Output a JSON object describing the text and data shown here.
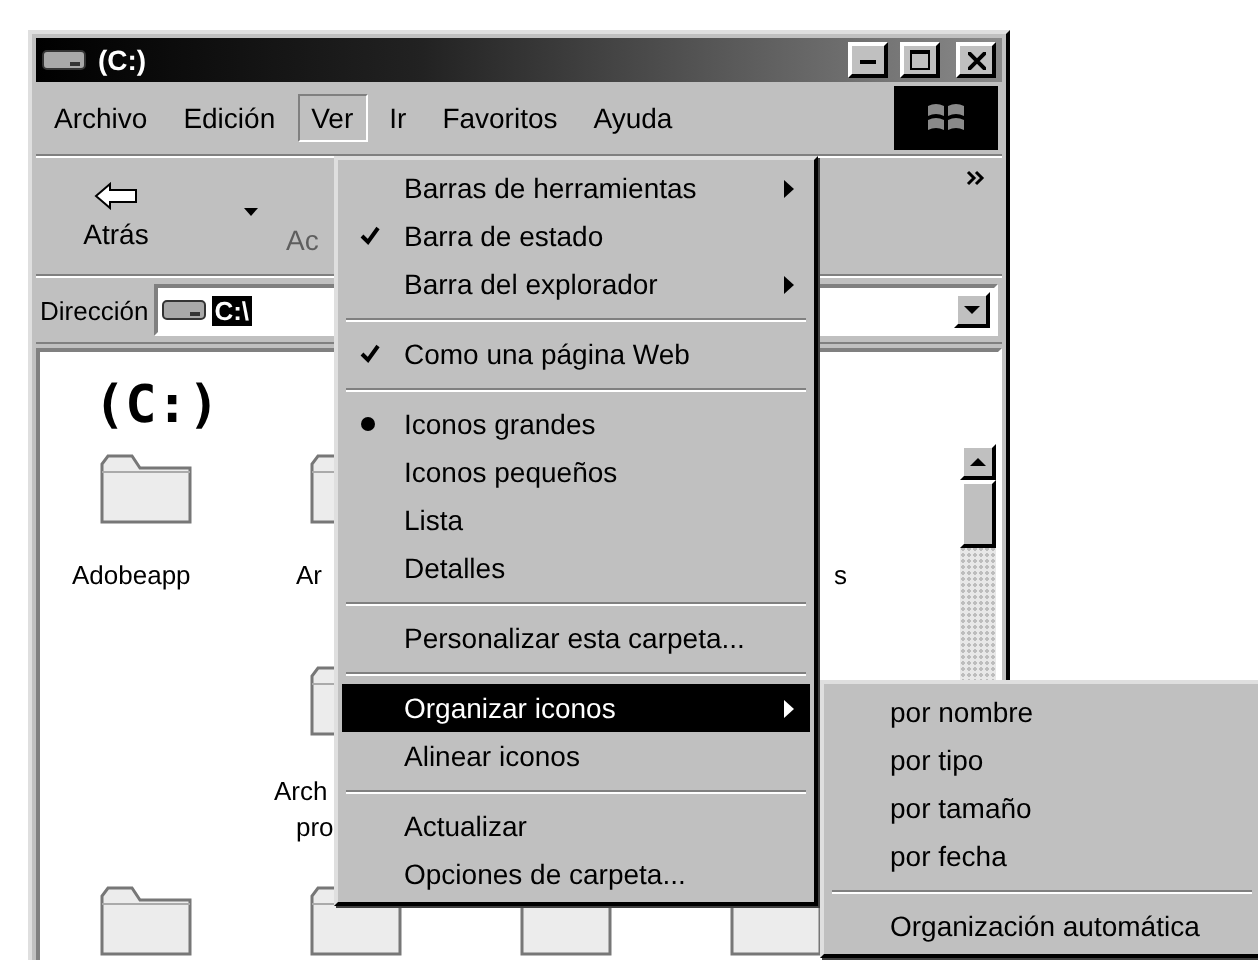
{
  "window": {
    "title": "(C:)"
  },
  "menubar": [
    {
      "label": "Archivo",
      "selected": false
    },
    {
      "label": "Edición",
      "selected": false
    },
    {
      "label": "Ver",
      "selected": true
    },
    {
      "label": "Ir",
      "selected": false
    },
    {
      "label": "Favoritos",
      "selected": false
    },
    {
      "label": "Ayuda",
      "selected": false
    }
  ],
  "toolbar": {
    "back": {
      "label": "Atrás",
      "disabled": false
    },
    "forward": {
      "label": "Ac",
      "disabled": true
    }
  },
  "address": {
    "label": "Dirección",
    "value": "C:\\"
  },
  "content": {
    "heading": "(C:)",
    "items": [
      {
        "label": "Adobeapp",
        "kind": "folder"
      },
      {
        "label": "Ar",
        "kind": "folder"
      },
      {
        "label": "s",
        "kind": "label"
      },
      {
        "label": "Arch",
        "kind": "folder"
      },
      {
        "label": "pro",
        "kind": "label"
      },
      {
        "kind": "folder"
      },
      {
        "kind": "folder"
      },
      {
        "kind": "folder"
      },
      {
        "kind": "folder"
      }
    ]
  },
  "view_menu": [
    {
      "label": "Barras de herramientas",
      "kind": "submenu",
      "selected": false
    },
    {
      "label": "Barra de estado",
      "kind": "check",
      "checked": true,
      "selected": false
    },
    {
      "label": "Barra del explorador",
      "kind": "submenu",
      "selected": false
    },
    {
      "kind": "separator"
    },
    {
      "label": "Como una página Web",
      "kind": "check",
      "checked": true,
      "selected": false
    },
    {
      "kind": "separator"
    },
    {
      "label": "Iconos grandes",
      "kind": "radio",
      "checked": true,
      "selected": false
    },
    {
      "label": "Iconos pequeños",
      "kind": "radio",
      "checked": false,
      "selected": false
    },
    {
      "label": "Lista",
      "kind": "radio",
      "checked": false,
      "selected": false
    },
    {
      "label": "Detalles",
      "kind": "radio",
      "checked": false,
      "selected": false
    },
    {
      "kind": "separator"
    },
    {
      "label": "Personalizar esta carpeta...",
      "kind": "command",
      "selected": false
    },
    {
      "kind": "separator"
    },
    {
      "label": "Organizar iconos",
      "kind": "submenu",
      "selected": true
    },
    {
      "label": "Alinear iconos",
      "kind": "command",
      "selected": false
    },
    {
      "kind": "separator"
    },
    {
      "label": "Actualizar",
      "kind": "command",
      "selected": false
    },
    {
      "label": "Opciones de carpeta...",
      "kind": "command",
      "selected": false
    }
  ],
  "arrange_submenu": [
    {
      "label": "por nombre",
      "kind": "command",
      "selected": false
    },
    {
      "label": "por tipo",
      "kind": "command",
      "selected": false
    },
    {
      "label": "por tamaño",
      "kind": "command",
      "selected": false
    },
    {
      "label": "por fecha",
      "kind": "command",
      "selected": false
    },
    {
      "kind": "separator"
    },
    {
      "label": "Organización automática",
      "kind": "command",
      "selected": false
    }
  ]
}
